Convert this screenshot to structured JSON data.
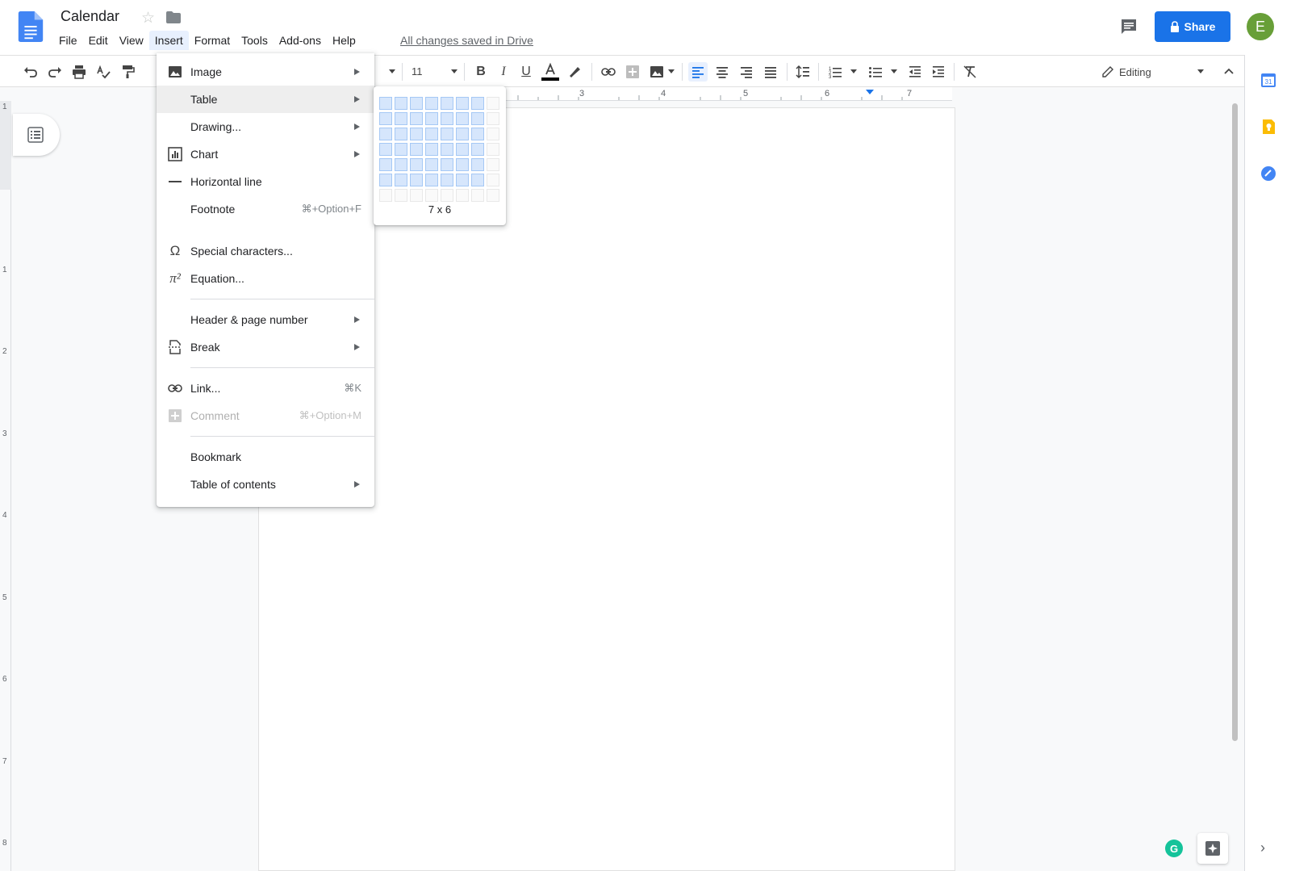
{
  "header": {
    "title": "Calendar",
    "menu": [
      "File",
      "Edit",
      "View",
      "Insert",
      "Format",
      "Tools",
      "Add-ons",
      "Help"
    ],
    "active_menu": "Insert",
    "saved_status": "All changes saved in Drive",
    "share_label": "Share",
    "avatar_letter": "E"
  },
  "toolbar": {
    "font_size": "11",
    "mode_label": "Editing"
  },
  "ruler": {
    "h_labels": [
      "3",
      "4",
      "5",
      "6",
      "7"
    ],
    "v_labels": [
      "1",
      "1",
      "2",
      "3",
      "4",
      "5",
      "6",
      "7",
      "8"
    ]
  },
  "insert_menu": {
    "items": [
      {
        "label": "Image",
        "icon": "image-icon",
        "submenu": true
      },
      {
        "label": "Table",
        "icon": "",
        "submenu": true,
        "highlighted": true
      },
      {
        "label": "Drawing...",
        "icon": "",
        "submenu": true
      },
      {
        "label": "Chart",
        "icon": "chart-icon",
        "submenu": true
      },
      {
        "label": "Horizontal line",
        "icon": "horizontal-line-icon"
      },
      {
        "label": "Footnote",
        "icon": "",
        "shortcut": "⌘+Option+F"
      },
      {
        "label": "Special characters...",
        "icon": "omega-icon"
      },
      {
        "label": "Equation...",
        "icon": "pi-icon"
      },
      {
        "label": "Header & page number",
        "icon": "",
        "submenu": true
      },
      {
        "label": "Break",
        "icon": "page-break-icon",
        "submenu": true
      },
      {
        "label": "Link...",
        "icon": "link-icon",
        "shortcut": "⌘K"
      },
      {
        "label": "Comment",
        "icon": "add-comment-icon",
        "shortcut": "⌘+Option+M",
        "disabled": true
      },
      {
        "label": "Bookmark",
        "icon": ""
      },
      {
        "label": "Table of contents",
        "icon": "",
        "submenu": true
      }
    ]
  },
  "table_picker": {
    "columns": 8,
    "rows": 7,
    "selected_columns": 7,
    "selected_rows": 6,
    "label": "7 x 6"
  },
  "colors": {
    "share": "#1a73e8",
    "avatar": "#689f38",
    "grid_selected": "#d6e6fc"
  }
}
